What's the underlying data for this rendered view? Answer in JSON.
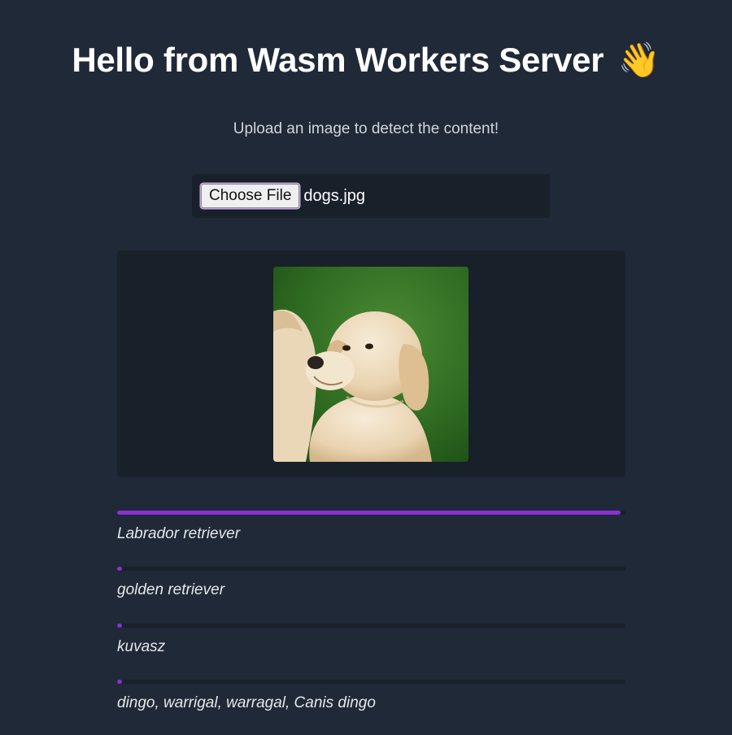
{
  "header": {
    "title": "Hello from Wasm Workers Server",
    "emoji": "👋"
  },
  "subtitle": "Upload an image to detect the content!",
  "file_input": {
    "button_label": "Choose File",
    "file_name": "dogs.jpg"
  },
  "preview": {
    "image": "puppy-photo"
  },
  "results": [
    {
      "label": "Labrador retriever",
      "score": 0.99
    },
    {
      "label": "golden retriever",
      "score": 0.01
    },
    {
      "label": "kuvasz",
      "score": 0.01
    },
    {
      "label": "dingo, warrigal, warragal, Canis dingo",
      "score": 0.01
    }
  ],
  "colors": {
    "background": "#1f2937",
    "panel": "#18202a",
    "accent": "#8b2fd6"
  }
}
